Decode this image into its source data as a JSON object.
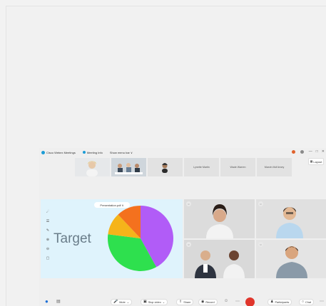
{
  "titlebar": {
    "app_name": "Cisco Webex Meetings",
    "meeting_info": "Meeting Info",
    "hide_menu": "Show menu bar ∨"
  },
  "thumbnails": [
    {
      "type": "photo",
      "name": ""
    },
    {
      "type": "photo",
      "name": ""
    },
    {
      "type": "avatar",
      "name": ""
    },
    {
      "type": "name",
      "name": "Lynette Martin"
    },
    {
      "type": "name",
      "name": "Wade Warren"
    },
    {
      "type": "name",
      "name": "Marvin McKinney"
    }
  ],
  "layout_label": "Layout",
  "presentation": {
    "file_label": "Presentation.pdf ∨",
    "slide_text": "Target"
  },
  "chart_data": {
    "type": "pie",
    "slices": [
      {
        "label": "",
        "value": 42,
        "color": "#b15cf7"
      },
      {
        "label": "",
        "value": 35,
        "color": "#2ee04e"
      },
      {
        "label": "",
        "value": 11,
        "color": "#f5b41a"
      },
      {
        "label": "",
        "value": 12,
        "color": "#f4711e"
      }
    ]
  },
  "toolbar": {
    "mute": "Mute",
    "stop_video": "Stop video",
    "share": "Share",
    "record": "Record",
    "participants": "Participants",
    "chat": "Chat"
  },
  "colors": {
    "end_call": "#e0362c",
    "share_bg": "#dff3fc"
  }
}
